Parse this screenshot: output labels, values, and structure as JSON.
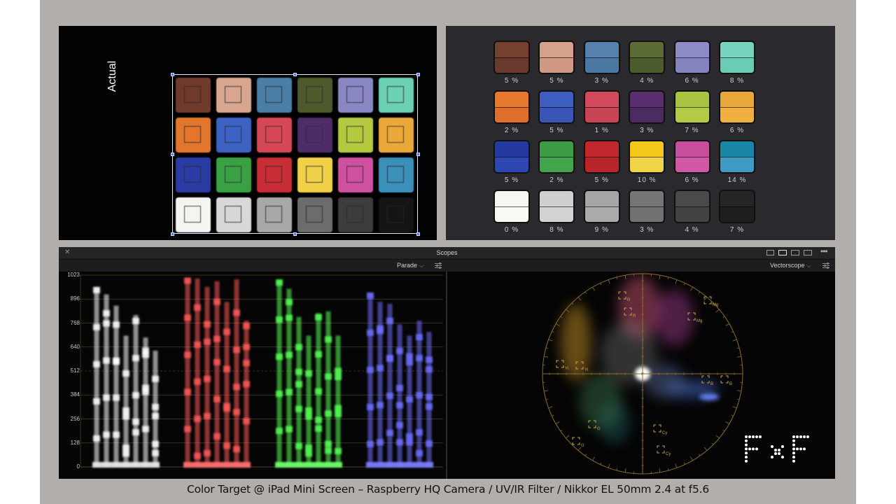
{
  "actual_panel": {
    "label": "Actual",
    "patches": [
      "#6f3a2a",
      "#d8a58e",
      "#4a7ea6",
      "#4e5a2c",
      "#8a88c4",
      "#6cd0b4",
      "#e2762c",
      "#3e62c4",
      "#d64858",
      "#4e2c68",
      "#b4c840",
      "#eba83a",
      "#2a3ca4",
      "#3aa044",
      "#c82c34",
      "#f0d048",
      "#d050a0",
      "#3a90b8",
      "#f4f4f0",
      "#d8d8d8",
      "#a8a8a8",
      "#6c6c6c",
      "#3c3c3c",
      "#141414"
    ]
  },
  "reference_panel": {
    "swatches": [
      {
        "top": "#754232",
        "bottom": "#6a3a2c",
        "pct": "5 %"
      },
      {
        "top": "#d7a28c",
        "bottom": "#cf9982",
        "pct": "5 %"
      },
      {
        "top": "#5681ad",
        "bottom": "#4b79a4",
        "pct": "3 %"
      },
      {
        "top": "#5a6c34",
        "bottom": "#4d5c2c",
        "pct": "4 %"
      },
      {
        "top": "#8d8cc8",
        "bottom": "#8583bf",
        "pct": "6 %"
      },
      {
        "top": "#78d4be",
        "bottom": "#69ccb4",
        "pct": "8 %"
      },
      {
        "top": "#e5782d",
        "bottom": "#de6f2a",
        "pct": "2 %"
      },
      {
        "top": "#3f5fc0",
        "bottom": "#3a55b5",
        "pct": "5 %"
      },
      {
        "top": "#d24a5c",
        "bottom": "#c84354",
        "pct": "1 %"
      },
      {
        "top": "#5a2f70",
        "bottom": "#4d2a62",
        "pct": "3 %"
      },
      {
        "top": "#a8c440",
        "bottom": "#b4cc45",
        "pct": "7 %"
      },
      {
        "top": "#e9a63a",
        "bottom": "#f0b03e",
        "pct": "6 %"
      },
      {
        "top": "#243aa0",
        "bottom": "#2c46b4",
        "pct": "5 %"
      },
      {
        "top": "#3d9c45",
        "bottom": "#42a44b",
        "pct": "2 %"
      },
      {
        "top": "#c0282e",
        "bottom": "#b8252b",
        "pct": "5 %"
      },
      {
        "top": "#f4c81a",
        "bottom": "#f2d44a",
        "pct": "10 %"
      },
      {
        "top": "#c64e9a",
        "bottom": "#d058a4",
        "pct": "6 %"
      },
      {
        "top": "#1a86a6",
        "bottom": "#3e9cc4",
        "pct": "14 %"
      },
      {
        "top": "#f6f6f2",
        "bottom": "#f9f9f6",
        "pct": "0 %"
      },
      {
        "top": "#cfcfcf",
        "bottom": "#d3d3d3",
        "pct": "8 %"
      },
      {
        "top": "#a6a6a6",
        "bottom": "#aaaaaa",
        "pct": "9 %"
      },
      {
        "top": "#767676",
        "bottom": "#727272",
        "pct": "3 %"
      },
      {
        "top": "#4a4a4a",
        "bottom": "#434343",
        "pct": "4 %"
      },
      {
        "top": "#252525",
        "bottom": "#1e1e1e",
        "pct": "7 %"
      }
    ]
  },
  "scopes": {
    "title": "Scopes",
    "left_mode": "Parade",
    "right_mode": "Vectorscope",
    "y_ticks": [
      "1023",
      "896",
      "768",
      "640",
      "512",
      "384",
      "256",
      "128",
      "0"
    ],
    "targets": [
      "R",
      "Mg",
      "B",
      "Cy",
      "G",
      "Yl"
    ]
  },
  "logo": {
    "text": "FxF"
  },
  "caption": "Color Target @ iPad Mini Screen – Raspberry HQ Camera / UV/IR Filter / Nikkor EL 50mm 2.4 at f5.6"
}
